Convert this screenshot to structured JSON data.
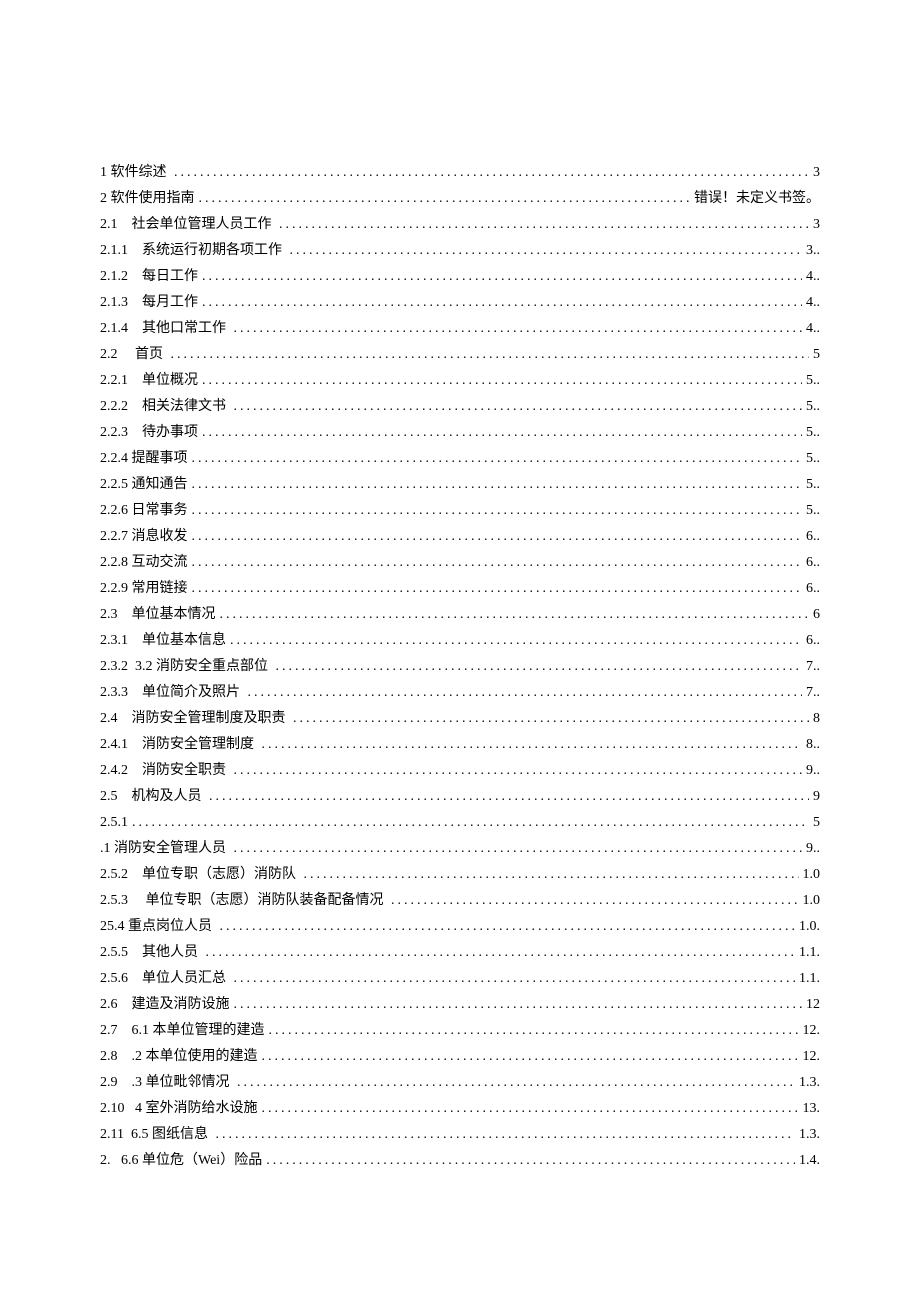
{
  "toc": [
    {
      "label": "1 软件综述 ",
      "page": " 3"
    },
    {
      "label": "2 软件使用指南",
      "page": " 错误！未定义书签。"
    },
    {
      "label": "2.1    社会单位管理人员工作 ",
      "page": " 3"
    },
    {
      "label": "2.1.1    系统运行初期各项工作 ",
      "page": " 3.."
    },
    {
      "label": "2.1.2    每日工作",
      "page": " 4.."
    },
    {
      "label": "2.1.3    每月工作",
      "page": " 4.."
    },
    {
      "label": "2.1.4    其他口常工作 ",
      "page": " 4.."
    },
    {
      "label": "2.2     首页 ",
      "page": " 5"
    },
    {
      "label": "2.2.1    单位概况",
      "page": " 5.."
    },
    {
      "label": "2.2.2    相关法律文书 ",
      "page": " 5.."
    },
    {
      "label": "2.2.3    待办事项",
      "page": " 5.."
    },
    {
      "label": "2.2.4 提醒事项",
      "page": " 5.."
    },
    {
      "label": "2.2.5 通知通告",
      "page": " 5.."
    },
    {
      "label": "2.2.6 日常事务",
      "page": " 5.."
    },
    {
      "label": "2.2.7 消息收发",
      "page": " 6.."
    },
    {
      "label": "2.2.8 互动交流",
      "page": " 6.."
    },
    {
      "label": "2.2.9 常用链接",
      "page": " 6.."
    },
    {
      "label": "2.3    单位基本情况",
      "page": " 6"
    },
    {
      "label": "2.3.1    单位基本信息",
      "page": " 6.."
    },
    {
      "label": "2.3.2  3.2 消防安全重点部位 ",
      "page": " 7.."
    },
    {
      "label": "2.3.3    单位简介及照片 ",
      "page": " 7.."
    },
    {
      "label": "2.4    消防安全管理制度及职责 ",
      "page": " 8"
    },
    {
      "label": "2.4.1    消防安全管理制度 ",
      "page": " 8.."
    },
    {
      "label": "2.4.2    消防安全职责 ",
      "page": " 9.."
    },
    {
      "label": "2.5    机构及人员 ",
      "page": " 9"
    },
    {
      "label": "2.5.1",
      "page": "5"
    },
    {
      "label": ".1 消防安全管理人员 ",
      "page": " 9.."
    },
    {
      "label": "2.5.2    单位专职（志愿）消防队 ",
      "page": " 1.0"
    },
    {
      "label": "2.5.3     单位专职（志愿）消防队装备配备情况 ",
      "page": " 1.0"
    },
    {
      "label": "25.4 重点岗位人员 ",
      "page": " 1.0."
    },
    {
      "label": "2.5.5    其他人员 ",
      "page": " 1.1."
    },
    {
      "label": "2.5.6    单位人员汇总 ",
      "page": " 1.1."
    },
    {
      "label": "2.6    建造及消防设施",
      "page": " 12"
    },
    {
      "label": "2.7    6.1 本单位管理的建造",
      "page": " 12."
    },
    {
      "label": "2.8    .2 本单位使用的建造",
      "page": " 12."
    },
    {
      "label": "2.9    .3 单位毗邻情况 ",
      "page": " 1.3."
    },
    {
      "label": "2.10   4 室外消防给水设施",
      "page": " 13."
    },
    {
      "label": "2.11  6.5 图纸信息 ",
      "page": " 1.3."
    },
    {
      "label": "2.   6.6 单位危（Wei）险品",
      "page": "1.4."
    }
  ]
}
